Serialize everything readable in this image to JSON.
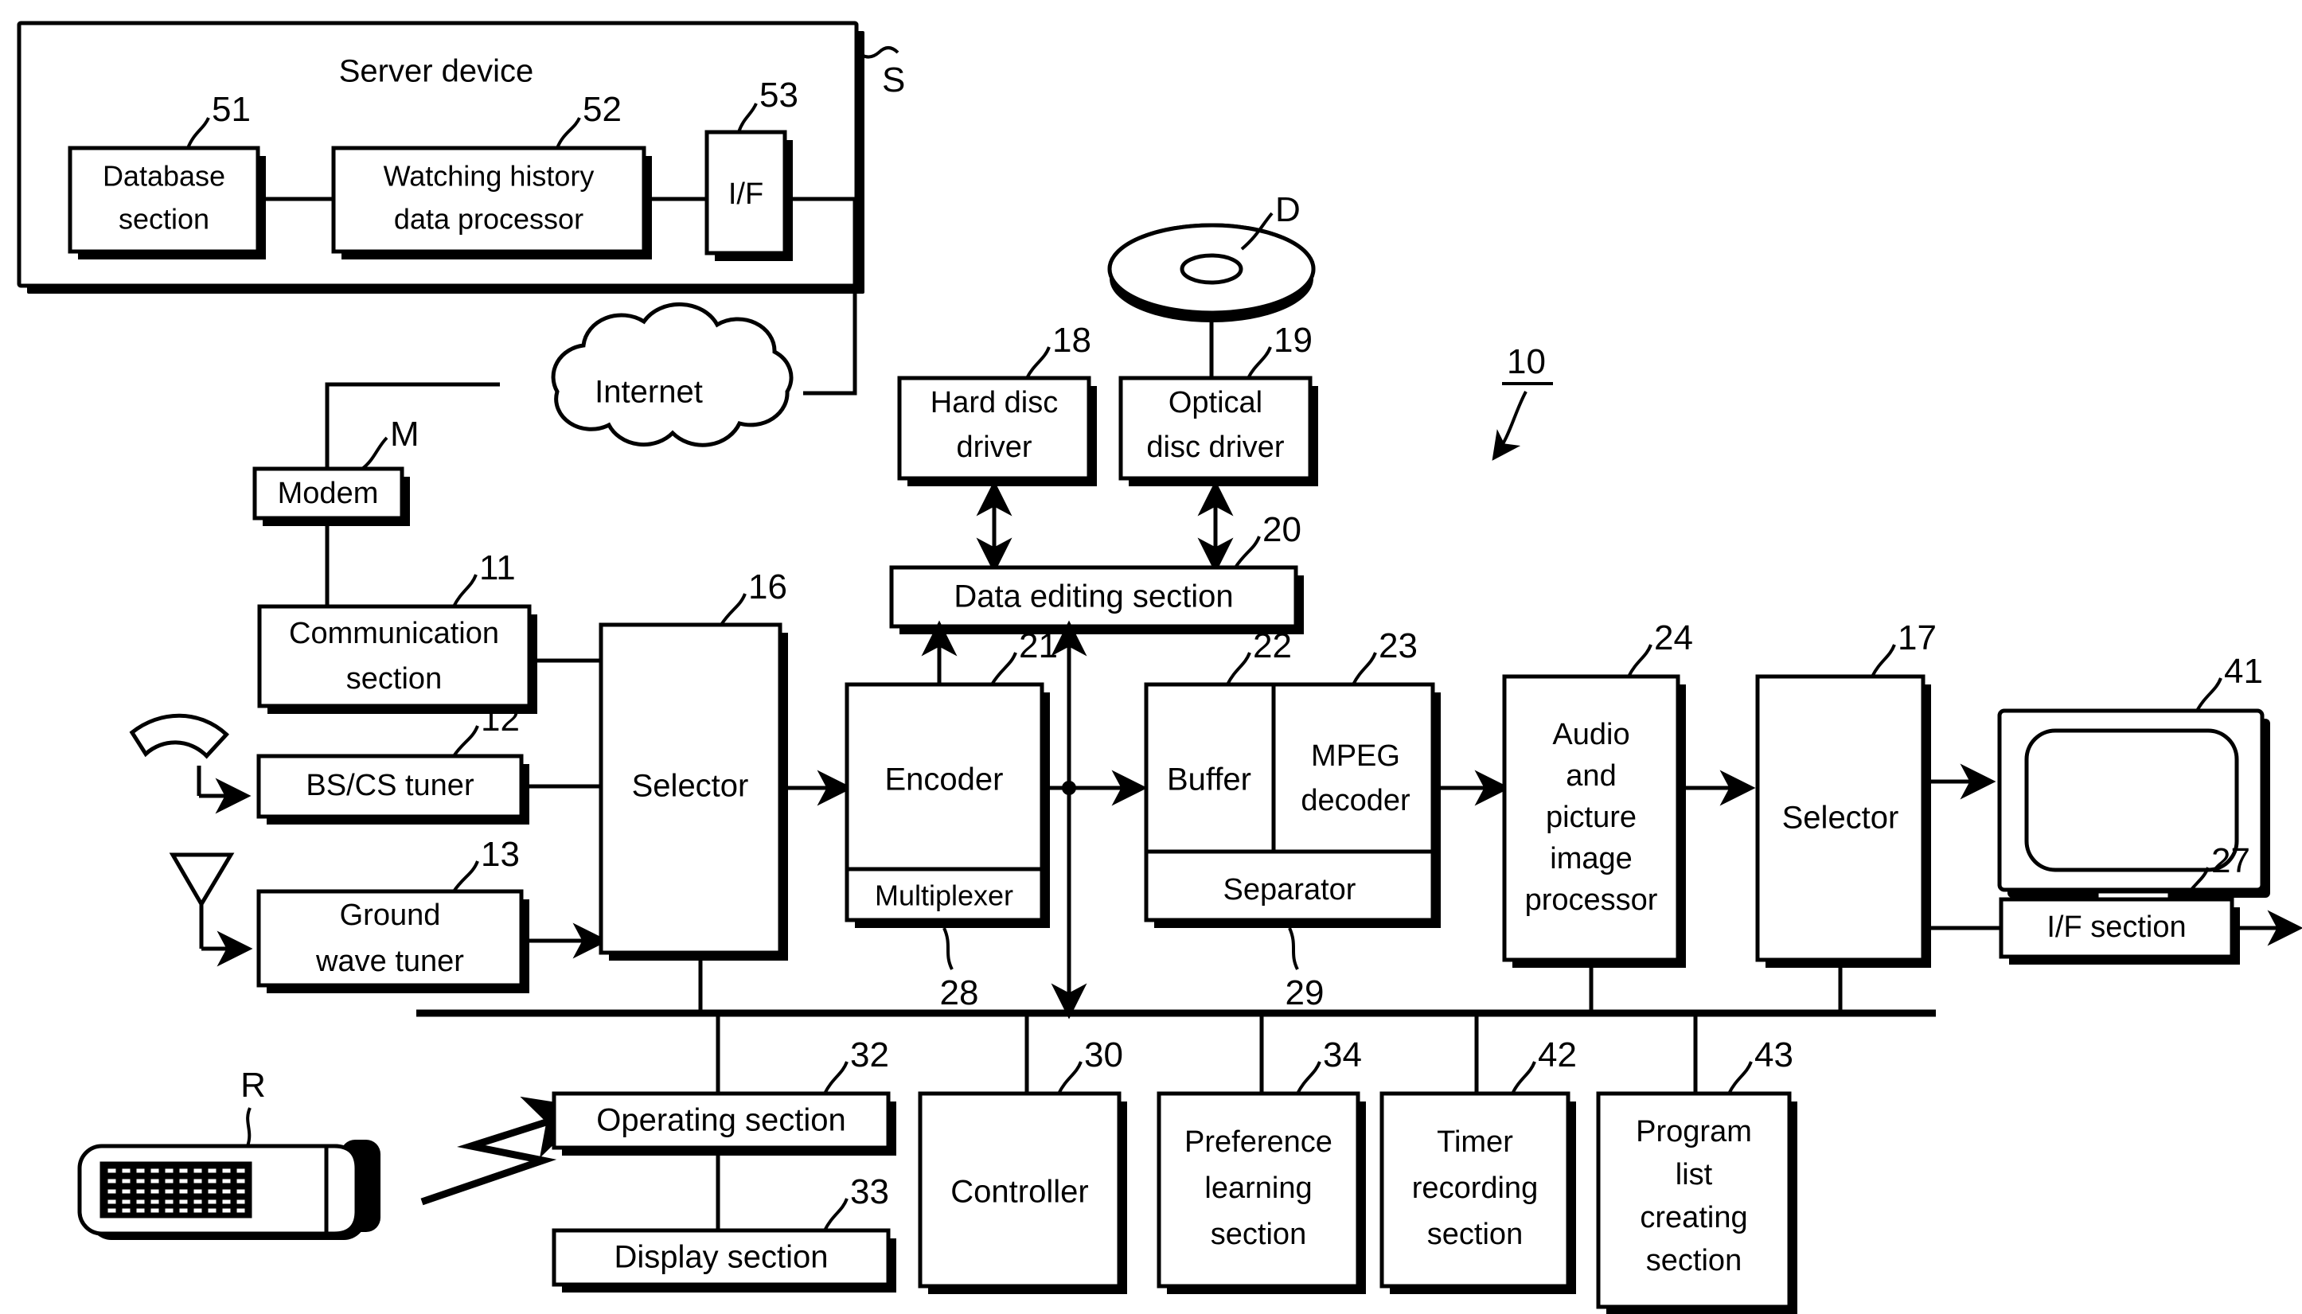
{
  "figure": {
    "overall_ref": "10",
    "server_ref": "S",
    "disc_ref": "D",
    "modem_ref": "M",
    "remote_ref": "R"
  },
  "server": {
    "title": "Server device",
    "blocks": [
      {
        "id": "database",
        "label_line1": "Database",
        "label_line2": "section",
        "ref": "51"
      },
      {
        "id": "watching",
        "label_line1": "Watching  history",
        "label_line2": "data  processor",
        "ref": "52"
      },
      {
        "id": "if",
        "label_line1": "I/F",
        "label_line2": "",
        "ref": "53"
      }
    ]
  },
  "network": {
    "cloud_label": "Internet",
    "modem_label": "Modem",
    "modem_ref": "M"
  },
  "blocks": [
    {
      "id": "communication",
      "ref": "11",
      "line1": "Communication",
      "line2": "section"
    },
    {
      "id": "bscs-tuner",
      "ref": "12",
      "line1": "BS/CS  tuner",
      "line2": ""
    },
    {
      "id": "ground-tuner",
      "ref": "13",
      "line1": "Ground",
      "line2": "wave  tuner"
    },
    {
      "id": "selector-16",
      "ref": "16",
      "line1": "Selector",
      "line2": ""
    },
    {
      "id": "selector-17",
      "ref": "17",
      "line1": "Selector",
      "line2": ""
    },
    {
      "id": "hard-disc",
      "ref": "18",
      "line1": "Hard  disc",
      "line2": "driver"
    },
    {
      "id": "optical-disc",
      "ref": "19",
      "line1": "Optical",
      "line2": "disc  driver"
    },
    {
      "id": "data-editing",
      "ref": "20",
      "line1": "Data  editing  section",
      "line2": ""
    },
    {
      "id": "encoder",
      "ref": "21",
      "line1": "Encoder",
      "line2": ""
    },
    {
      "id": "multiplexer",
      "ref": "28",
      "line1": "Multiplexer",
      "line2": ""
    },
    {
      "id": "buffer",
      "ref": "22",
      "line1": "Buffer",
      "line2": ""
    },
    {
      "id": "mpeg-decoder",
      "ref": "23",
      "line1": "MPEG",
      "line2": "decoder"
    },
    {
      "id": "separator",
      "ref": "29",
      "line1": "Separator",
      "line2": ""
    },
    {
      "id": "av-processor",
      "ref": "24",
      "line1": "Audio and picture image processor",
      "line2": ""
    },
    {
      "id": "if-section",
      "ref": "27",
      "line1": "I/F  section",
      "line2": ""
    },
    {
      "id": "monitor",
      "ref": "41",
      "line1": "",
      "line2": ""
    },
    {
      "id": "operating",
      "ref": "32",
      "line1": "Operating  section",
      "line2": ""
    },
    {
      "id": "display",
      "ref": "33",
      "line1": "Display  section",
      "line2": ""
    },
    {
      "id": "controller",
      "ref": "30",
      "line1": "Controller",
      "line2": ""
    },
    {
      "id": "preference",
      "ref": "34",
      "line1": "Preference learning section",
      "line2": ""
    },
    {
      "id": "timer",
      "ref": "42",
      "line1": "Timer recording section",
      "line2": ""
    },
    {
      "id": "program-list",
      "ref": "43",
      "line1": "Program list creating section",
      "line2": ""
    }
  ],
  "labels": {
    "server_device": "Server device",
    "database_l1": "Database",
    "database_l2": "section",
    "watching_l1": "Watching  history",
    "watching_l2": "data  processor",
    "if_small": "I/F",
    "internet": "Internet",
    "modem": "Modem",
    "communication_l1": "Communication",
    "communication_l2": "section",
    "bscs_tuner": "BS/CS  tuner",
    "ground_l1": "Ground",
    "ground_l2": "wave  tuner",
    "selector16": "Selector",
    "selector17": "Selector",
    "hard_l1": "Hard  disc",
    "hard_l2": "driver",
    "optical_l1": "Optical",
    "optical_l2": "disc  driver",
    "data_editing": "Data  editing  section",
    "encoder": "Encoder",
    "multiplexer": "Multiplexer",
    "buffer": "Buffer",
    "mpeg_l1": "MPEG",
    "mpeg_l2": "decoder",
    "separator": "Separator",
    "av_l1": "Audio",
    "av_l2": "and",
    "av_l3": "picture",
    "av_l4": "image",
    "av_l5": "processor",
    "if_section": "I/F  section",
    "operating": "Operating  section",
    "display": "Display  section",
    "controller": "Controller",
    "pref_l1": "Preference",
    "pref_l2": "learning",
    "pref_l3": "section",
    "timer_l1": "Timer",
    "timer_l2": "recording",
    "timer_l3": "section",
    "prog_l1": "Program",
    "prog_l2": "list",
    "prog_l3": "creating",
    "prog_l4": "section"
  },
  "refs": {
    "r10": "10",
    "r11": "11",
    "r12": "12",
    "r13": "13",
    "r16": "16",
    "r17": "17",
    "r18": "18",
    "r19": "19",
    "r20": "20",
    "r21": "21",
    "r22": "22",
    "r23": "23",
    "r24": "24",
    "r27": "27",
    "r28": "28",
    "r29": "29",
    "r30": "30",
    "r32": "32",
    "r33": "33",
    "r34": "34",
    "r41": "41",
    "r42": "42",
    "r43": "43",
    "r51": "51",
    "r52": "52",
    "r53": "53",
    "rS": "S",
    "rD": "D",
    "rM": "M",
    "rR": "R"
  },
  "colors": {
    "ink": "#000000",
    "paper": "#ffffff"
  }
}
